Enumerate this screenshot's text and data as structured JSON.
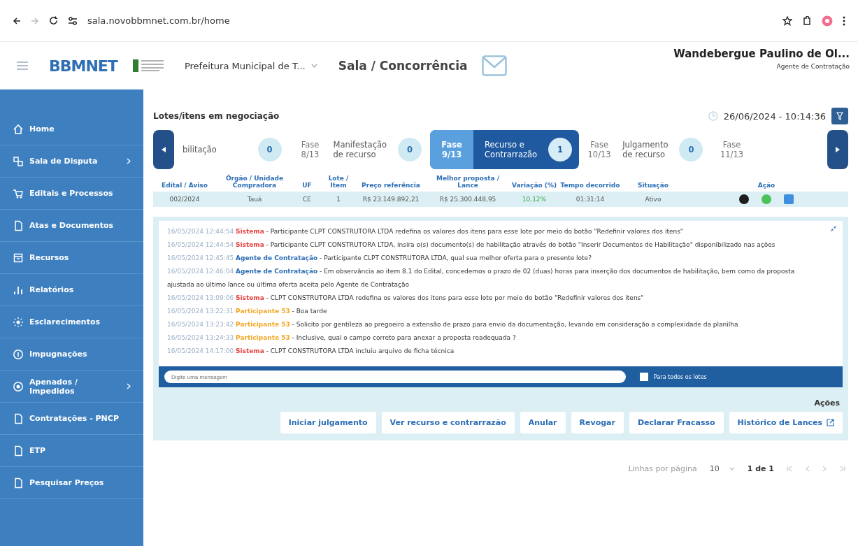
{
  "browser": {
    "url": "sala.novobbmnet.com.br/home"
  },
  "header": {
    "logo": "BBMNET",
    "organization": "Prefeitura Municipal de T...",
    "title": "Sala / Concorrência",
    "user_name": "Wandebergue Paulino de Ol...",
    "user_role": "Agente de Contratação"
  },
  "sidebar": {
    "items": [
      {
        "label": "Home",
        "has_submenu": false
      },
      {
        "label": "Sala de Disputa",
        "has_submenu": true
      },
      {
        "label": "Editais e Processos",
        "has_submenu": false
      },
      {
        "label": "Atas e Documentos",
        "has_submenu": false
      },
      {
        "label": "Recursos",
        "has_submenu": false
      },
      {
        "label": "Relatórios",
        "has_submenu": false
      },
      {
        "label": "Esclarecimentos",
        "has_submenu": false
      },
      {
        "label": "Impugnações",
        "has_submenu": false
      },
      {
        "label": "Apenados / Impedidos",
        "has_submenu": true
      },
      {
        "label": "Contratações - PNCP",
        "has_submenu": false
      },
      {
        "label": "ETP",
        "has_submenu": false
      },
      {
        "label": "Pesquisar Preços",
        "has_submenu": false
      }
    ]
  },
  "main": {
    "title": "Lotes/itens em negociação",
    "datetime": "26/06/2024 - 10:14:36",
    "phases": [
      {
        "name": "bilitação",
        "count": "0",
        "selected": false
      },
      {
        "fase": "Fase 8/13",
        "name": "Manifestação de recurso",
        "count": "0",
        "selected": false
      },
      {
        "fase": "Fase 9/13",
        "name": "Recurso e Contrarrazão",
        "count": "1",
        "selected": true
      },
      {
        "fase": "Fase 10/13",
        "name": "Julgamento de recurso",
        "count": "0",
        "selected": false
      },
      {
        "fase": "Fase 11/13",
        "selected": false
      }
    ],
    "table": {
      "columns": [
        "Edital / Aviso",
        "Órgão / Unidade Compradora",
        "UF",
        "Lote / Item",
        "Preço referência",
        "Melhor proposta / Lance",
        "Variação (%)",
        "Tempo decorrido",
        "Situação",
        "Ação"
      ],
      "rows": [
        {
          "cells": [
            "002/2024",
            "Tauá",
            "CE",
            "1",
            "R$ 23.149.892,21",
            "R$ 25.300.448,95",
            "10,12%",
            "01:31:14",
            "Ativo"
          ]
        }
      ]
    },
    "chat": {
      "messages": [
        {
          "time": "16/05/2024 12:44:54",
          "author": "Sistema",
          "kind": "system",
          "text": "- Participante CLPT CONSTRUTORA LTDA redefina os valores dos itens para esse lote por meio do botão \"Redefinir valores dos itens\""
        },
        {
          "time": "16/05/2024 12:44:54",
          "author": "Sistema",
          "kind": "system",
          "text": "- Participante CLPT CONSTRUTORA LTDA, insira o(s) documento(s) de habilitação através do botão \"Inserir Documentos de Habilitação\" disponibilizado nas ações"
        },
        {
          "time": "16/05/2024 12:45:45",
          "author": "Agente de Contratação",
          "kind": "agent",
          "text": "- Participante CLPT CONSTRUTORA LTDA, qual sua melhor oferta para o presente lote?"
        },
        {
          "time": "16/05/2024 12:46:04",
          "author": "Agente de Contratação",
          "kind": "agent",
          "text": "- Em observância ao item 8.1 do Edital, concedemos o prazo de 02 (duas) horas para inserção dos documentos de habilitação, bem como da proposta ajustada ao último lance ou última oferta aceita pelo Agente de Contratação"
        },
        {
          "time": "16/05/2024 13:09:06",
          "author": "Sistema",
          "kind": "system",
          "text": "- CLPT CONSTRUTORA LTDA redefina os valores dos itens para esse lote por meio do botão \"Redefinir valores dos itens\""
        },
        {
          "time": "16/05/2024 13:22:31",
          "author": "Participante 53",
          "kind": "participant",
          "text": "- Boa tarde"
        },
        {
          "time": "16/05/2024 13:23:42",
          "author": "Participante 53",
          "kind": "participant",
          "text": "- Solicito por gentileza ao pregoeiro a extensão de prazo para envio da documentação, levando em consideração a complexidade da planilha"
        },
        {
          "time": "16/05/2024 13:24:33",
          "author": "Participante 53",
          "kind": "participant",
          "text": "- Inclusive, qual o campo correto para anexar a proposta readequada ?"
        },
        {
          "time": "16/05/2024 14:17:00",
          "author": "Sistema",
          "kind": "system",
          "text": "- CLPT CONSTRUTORA LTDA incluiu arquivo de ficha técnica"
        }
      ],
      "placeholder": "Digite uma mensagem",
      "all_lots_label": "Para todos os lotes",
      "all_lots_checked": false
    },
    "actions_title": "Ações",
    "actions": [
      "Iniciar julgamento",
      "Ver recurso e contrarrazão",
      "Anular",
      "Revogar",
      "Declarar Fracasso",
      "Histórico de Lances"
    ],
    "pagination": {
      "rows_label": "Linhas por página",
      "rows_value": "10",
      "range": "1 de 1"
    }
  }
}
